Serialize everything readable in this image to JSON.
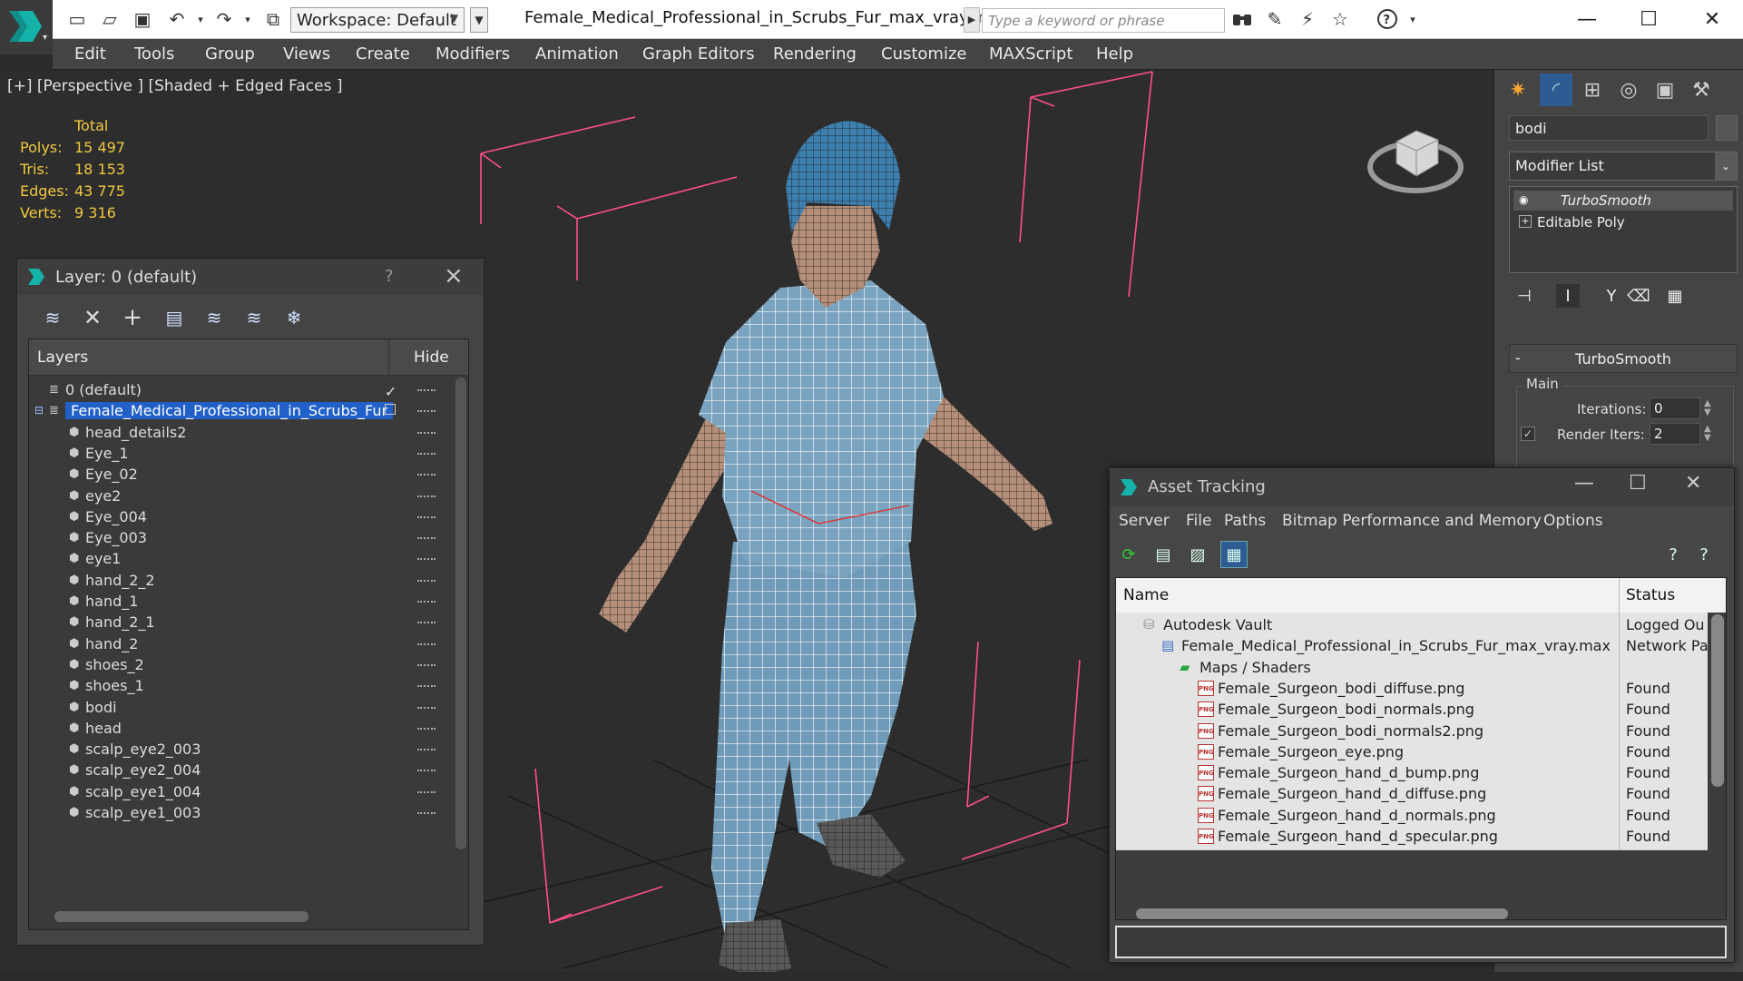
{
  "titlebar": {
    "workspace": "Workspace: Default",
    "doc_title": "Female_Medical_Professional_in_Scrubs_Fur_max_vray.max",
    "search_placeholder": "Type a keyword or phrase"
  },
  "menu": [
    "Edit",
    "Tools",
    "Group",
    "Views",
    "Create",
    "Modifiers",
    "Animation",
    "Graph Editors",
    "Rendering",
    "Customize",
    "MAXScript",
    "Help"
  ],
  "viewport": {
    "label": "[+] [Perspective ] [Shaded + Edged Faces ]",
    "stats": {
      "header": "Total",
      "rows": [
        {
          "label": "Polys:",
          "value": "15 497"
        },
        {
          "label": "Tris:",
          "value": "18 153"
        },
        {
          "label": "Edges:",
          "value": "43 775"
        },
        {
          "label": "Verts:",
          "value": "9 316"
        }
      ]
    }
  },
  "layer_panel": {
    "title": "Layer: 0 (default)",
    "help": "?",
    "col_layers": "Layers",
    "col_hide": "Hide",
    "rows": [
      {
        "name": "0 (default)",
        "type": "layer",
        "indent": 0,
        "checked": true
      },
      {
        "name": "Female_Medical_Professional_in_Scrubs_Fur",
        "type": "layer",
        "indent": 0,
        "selected": true
      },
      {
        "name": "head_details2",
        "type": "object",
        "indent": 1
      },
      {
        "name": "Eye_1",
        "type": "object",
        "indent": 1
      },
      {
        "name": "Eye_02",
        "type": "object",
        "indent": 1
      },
      {
        "name": "eye2",
        "type": "object",
        "indent": 1
      },
      {
        "name": "Eye_004",
        "type": "object",
        "indent": 1
      },
      {
        "name": "Eye_003",
        "type": "object",
        "indent": 1
      },
      {
        "name": "eye1",
        "type": "object",
        "indent": 1
      },
      {
        "name": "hand_2_2",
        "type": "object",
        "indent": 1
      },
      {
        "name": "hand_1",
        "type": "object",
        "indent": 1
      },
      {
        "name": "hand_2_1",
        "type": "object",
        "indent": 1
      },
      {
        "name": "hand_2",
        "type": "object",
        "indent": 1
      },
      {
        "name": "shoes_2",
        "type": "object",
        "indent": 1
      },
      {
        "name": "shoes_1",
        "type": "object",
        "indent": 1
      },
      {
        "name": "bodi",
        "type": "object",
        "indent": 1
      },
      {
        "name": "head",
        "type": "object",
        "indent": 1
      },
      {
        "name": "scalp_eye2_003",
        "type": "object",
        "indent": 1
      },
      {
        "name": "scalp_eye2_004",
        "type": "object",
        "indent": 1
      },
      {
        "name": "scalp_eye1_004",
        "type": "object",
        "indent": 1
      },
      {
        "name": "scalp_eye1_003",
        "type": "object",
        "indent": 1
      }
    ]
  },
  "command_panel": {
    "object_name": "bodi",
    "modifier_list": "Modifier List",
    "stack": [
      "TurboSmooth",
      "Editable Poly"
    ],
    "rollout_title": "TurboSmooth",
    "group_main": "Main",
    "iterations_label": "Iterations:",
    "iterations_value": "0",
    "render_iters_label": "Render Iters:",
    "render_iters_value": "2"
  },
  "asset_tracking": {
    "title": "Asset Tracking",
    "menu": [
      "Server",
      "File",
      "Paths",
      "Bitmap Performance and Memory",
      "Options"
    ],
    "col_name": "Name",
    "col_status": "Status",
    "rows": [
      {
        "name": "Autodesk Vault",
        "status": "Logged Ou",
        "icon": "vault-icon",
        "indent": 0
      },
      {
        "name": "Female_Medical_Professional_in_Scrubs_Fur_max_vray.max",
        "status": "Network Pa",
        "icon": "max-file-icon",
        "indent": 1
      },
      {
        "name": "Maps / Shaders",
        "status": "",
        "icon": "maps-icon",
        "indent": 2
      },
      {
        "name": "Female_Surgeon_bodi_diffuse.png",
        "status": "Found",
        "icon": "png-icon",
        "indent": 3
      },
      {
        "name": "Female_Surgeon_bodi_normals.png",
        "status": "Found",
        "icon": "png-icon",
        "indent": 3
      },
      {
        "name": "Female_Surgeon_bodi_normals2.png",
        "status": "Found",
        "icon": "png-icon",
        "indent": 3
      },
      {
        "name": "Female_Surgeon_eye.png",
        "status": "Found",
        "icon": "png-icon",
        "indent": 3
      },
      {
        "name": "Female_Surgeon_hand_d_bump.png",
        "status": "Found",
        "icon": "png-icon",
        "indent": 3
      },
      {
        "name": "Female_Surgeon_hand_d_diffuse.png",
        "status": "Found",
        "icon": "png-icon",
        "indent": 3
      },
      {
        "name": "Female_Surgeon_hand_d_normals.png",
        "status": "Found",
        "icon": "png-icon",
        "indent": 3
      },
      {
        "name": "Female_Surgeon_hand_d_specular.png",
        "status": "Found",
        "icon": "png-icon",
        "indent": 3
      }
    ]
  },
  "colors": {
    "selection": "#2060c8",
    "stats_text": "#f0c840",
    "bounding_box": "#ff4f8a",
    "scrubs": "#6f9bb8",
    "skin": "#b58f7a",
    "cap": "#3e7fae"
  }
}
